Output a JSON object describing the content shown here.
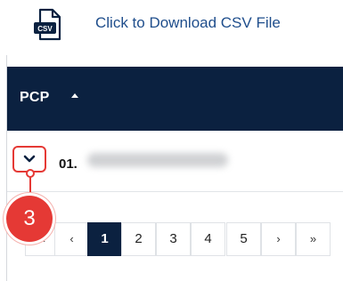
{
  "header": {
    "download_icon": "csv-file-icon",
    "download_link": "Click to Download CSV File"
  },
  "table": {
    "column_header": "PCP",
    "sort_icon": "sort-ascending-icon",
    "rows": [
      {
        "number": "01.",
        "expand_icon": "chevron-down-icon"
      }
    ]
  },
  "annotation": {
    "step": "3",
    "color": "#e53935"
  },
  "pagination": {
    "first": "«",
    "prev": "‹",
    "pages": [
      "1",
      "2",
      "3",
      "4",
      "5"
    ],
    "active_page": "1",
    "next": "›",
    "last": "»"
  },
  "colors": {
    "header_bg": "#0b2140",
    "link": "#1f4e8c",
    "highlight": "#e53935"
  }
}
